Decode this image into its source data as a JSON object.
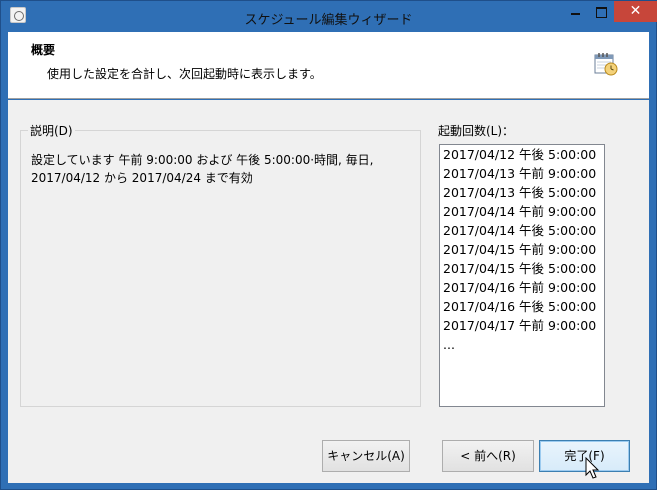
{
  "window": {
    "title": "スケジュール編集ウィザード",
    "close_glyph": "✕"
  },
  "header": {
    "title": "概要",
    "subtitle": "使用した設定を合計し、次回起動時に表示します。"
  },
  "description": {
    "label": "説明(D)",
    "text_line1": "設定しています 午前 9:00:00 および 午後 5:00:00·時間, 毎日,",
    "text_line2": "2017/04/12 から 2017/04/24 まで有効"
  },
  "run_times": {
    "label": "起動回数(L)：",
    "items": [
      "2017/04/12 午後 5:00:00",
      "2017/04/13 午前 9:00:00",
      "2017/04/13 午後 5:00:00",
      "2017/04/14 午前 9:00:00",
      "2017/04/14 午後 5:00:00",
      "2017/04/15 午前 9:00:00",
      "2017/04/15 午後 5:00:00",
      "2017/04/16 午前 9:00:00",
      "2017/04/16 午後 5:00:00",
      "2017/04/17 午前 9:00:00",
      "..."
    ]
  },
  "buttons": {
    "cancel": "キャンセル(A)",
    "back": "< 前へ(R)",
    "finish": "完了(F)"
  },
  "colors": {
    "title_bar": "#2f6fb5",
    "close_button": "#c7463a",
    "default_button_border": "#3c7fb1"
  }
}
